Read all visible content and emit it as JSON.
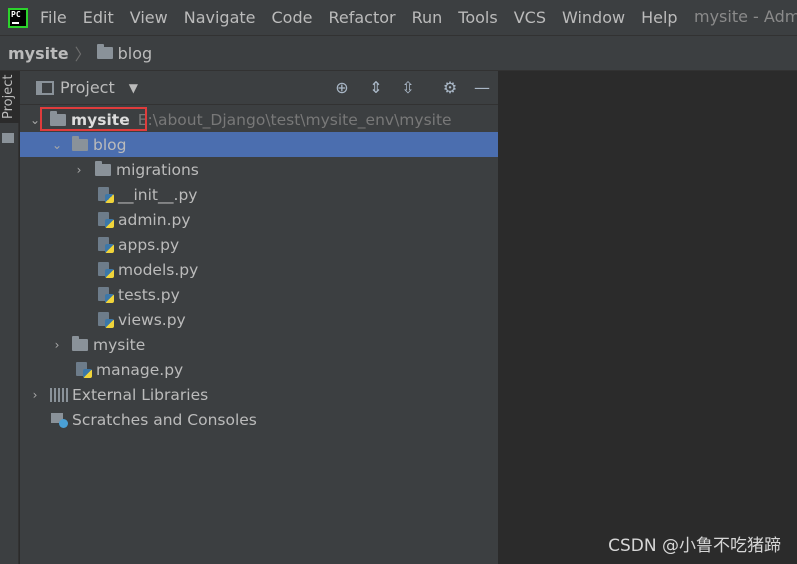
{
  "menubar": {
    "items": [
      "File",
      "Edit",
      "View",
      "Navigate",
      "Code",
      "Refactor",
      "Run",
      "Tools",
      "VCS",
      "Window",
      "Help"
    ],
    "window_title": "mysite - Admin"
  },
  "breadcrumb": {
    "root": "mysite",
    "leaf": "blog"
  },
  "toolstrip": {
    "project_label": "Project"
  },
  "panel": {
    "title": "Project"
  },
  "tree": {
    "root_name": "mysite",
    "root_path": "E:\\about_Django\\test\\mysite_env\\mysite",
    "blog": "blog",
    "migrations": "migrations",
    "init": "__init__.py",
    "admin": "admin.py",
    "apps": "apps.py",
    "models": "models.py",
    "tests": "tests.py",
    "views": "views.py",
    "mysite_pkg": "mysite",
    "manage": "manage.py",
    "external_libraries": "External Libraries",
    "scratches": "Scratches and Consoles"
  },
  "watermark": "CSDN @小鲁不吃猪蹄",
  "colors": {
    "selection": "#4b6eaf",
    "highlight_box": "#e03c3c"
  }
}
